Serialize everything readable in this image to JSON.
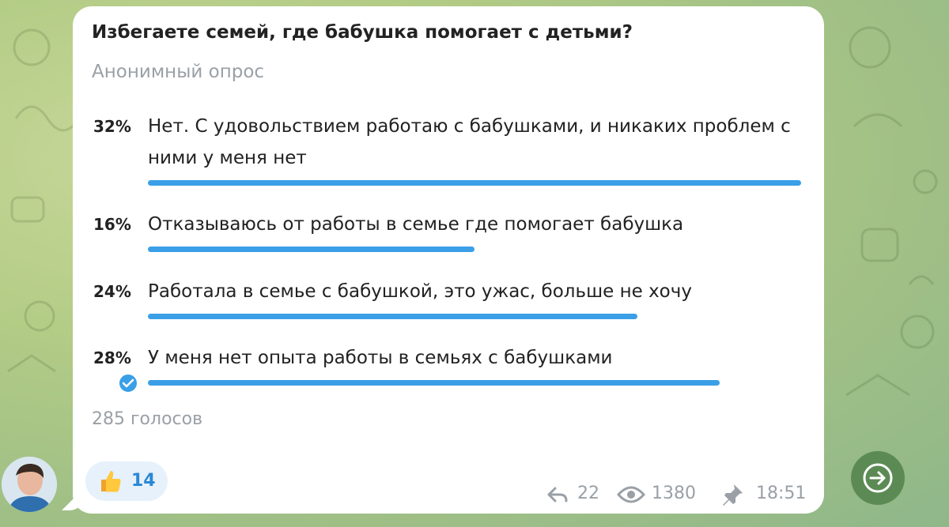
{
  "poll": {
    "question": "Избегаете семей, где бабушка помогает с детьми?",
    "type": "Анонимный опрос",
    "options": [
      {
        "percent": "32%",
        "label": "Нет. С удовольствием работаю с бабушками, и никаких проблем с ними у меня нет",
        "fraction": 0.32,
        "selected": false
      },
      {
        "percent": "16%",
        "label": "Отказываюсь от работы в семье где помогает бабушка",
        "fraction": 0.16,
        "selected": false
      },
      {
        "percent": "24%",
        "label": "Работала в семье с бабушкой, это ужас, больше не хочу",
        "fraction": 0.24,
        "selected": false
      },
      {
        "percent": "28%",
        "label": "У меня нет опыта работы в семьях с бабушками",
        "fraction": 0.28,
        "selected": true
      }
    ],
    "votes": "285 голосов"
  },
  "reaction": {
    "emoji": "thumbs-up-icon",
    "count": "14"
  },
  "meta": {
    "replies": "22",
    "views": "1380",
    "time": "18:51"
  },
  "colors": {
    "accent": "#3a9fe6",
    "bubble": "#ffffff",
    "muted": "#9aa0a6"
  }
}
